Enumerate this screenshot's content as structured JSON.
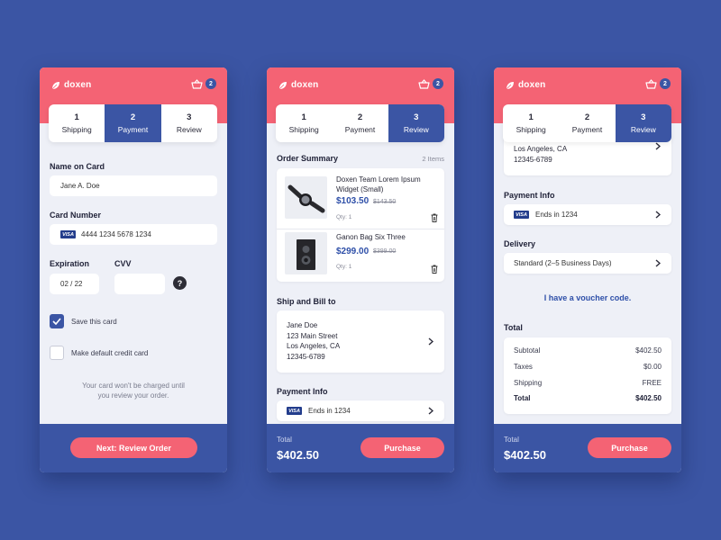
{
  "brand": {
    "name": "doxen",
    "cart_count": "2"
  },
  "steps": [
    {
      "num": "1",
      "label": "Shipping"
    },
    {
      "num": "2",
      "label": "Payment"
    },
    {
      "num": "3",
      "label": "Review"
    }
  ],
  "payment_screen": {
    "name_label": "Name on Card",
    "name_value": "Jane A. Doe",
    "card_label": "Card Number",
    "card_brand": "VISA",
    "card_value": "4444 1234 5678 1234",
    "exp_label": "Expiration",
    "exp_value": "02 / 22",
    "cvv_label": "CVV",
    "cvv_value": "",
    "help": "?",
    "save_card_label": "Save this card",
    "save_card_checked": true,
    "default_card_label": "Make default credit card",
    "default_card_checked": false,
    "note_line1": "Your card won't be charged until",
    "note_line2": "you review your order.",
    "next_button": "Next: Review Order"
  },
  "review_screen": {
    "summary_title": "Order Summary",
    "items_count": "2 Items",
    "products": [
      {
        "name": "Doxen Team Lorem Ipsum Widget (Small)",
        "price": "$103.50",
        "old_price": "$143.50",
        "qty": "Qty: 1"
      },
      {
        "name": "Ganon Bag Six Three",
        "price": "$299.00",
        "old_price": "$399.00",
        "qty": "Qty: 1"
      }
    ],
    "ship_title": "Ship and Bill to",
    "address": [
      "Jane Doe",
      "123 Main Street",
      "Los Angeles, CA",
      "12345-6789"
    ],
    "payment_title": "Payment Info",
    "payment_value": "Ends in 1234",
    "total_label": "Total",
    "total_value": "$402.50",
    "purchase_button": "Purchase"
  },
  "review_scrolled": {
    "address_visible": [
      "Los Angeles, CA",
      "12345-6789"
    ],
    "payment_title": "Payment Info",
    "payment_value": "Ends in 1234",
    "delivery_title": "Delivery",
    "delivery_value": "Standard (2–5 Business Days)",
    "voucher_link": "I have a voucher code.",
    "total_title": "Total",
    "rows": [
      {
        "label": "Subtotal",
        "value": "$402.50"
      },
      {
        "label": "Taxes",
        "value": "$0.00"
      },
      {
        "label": "Shipping",
        "value": "FREE"
      },
      {
        "label": "Total",
        "value": "$402.50"
      }
    ],
    "total_label": "Total",
    "total_value": "$402.50",
    "purchase_button": "Purchase"
  }
}
